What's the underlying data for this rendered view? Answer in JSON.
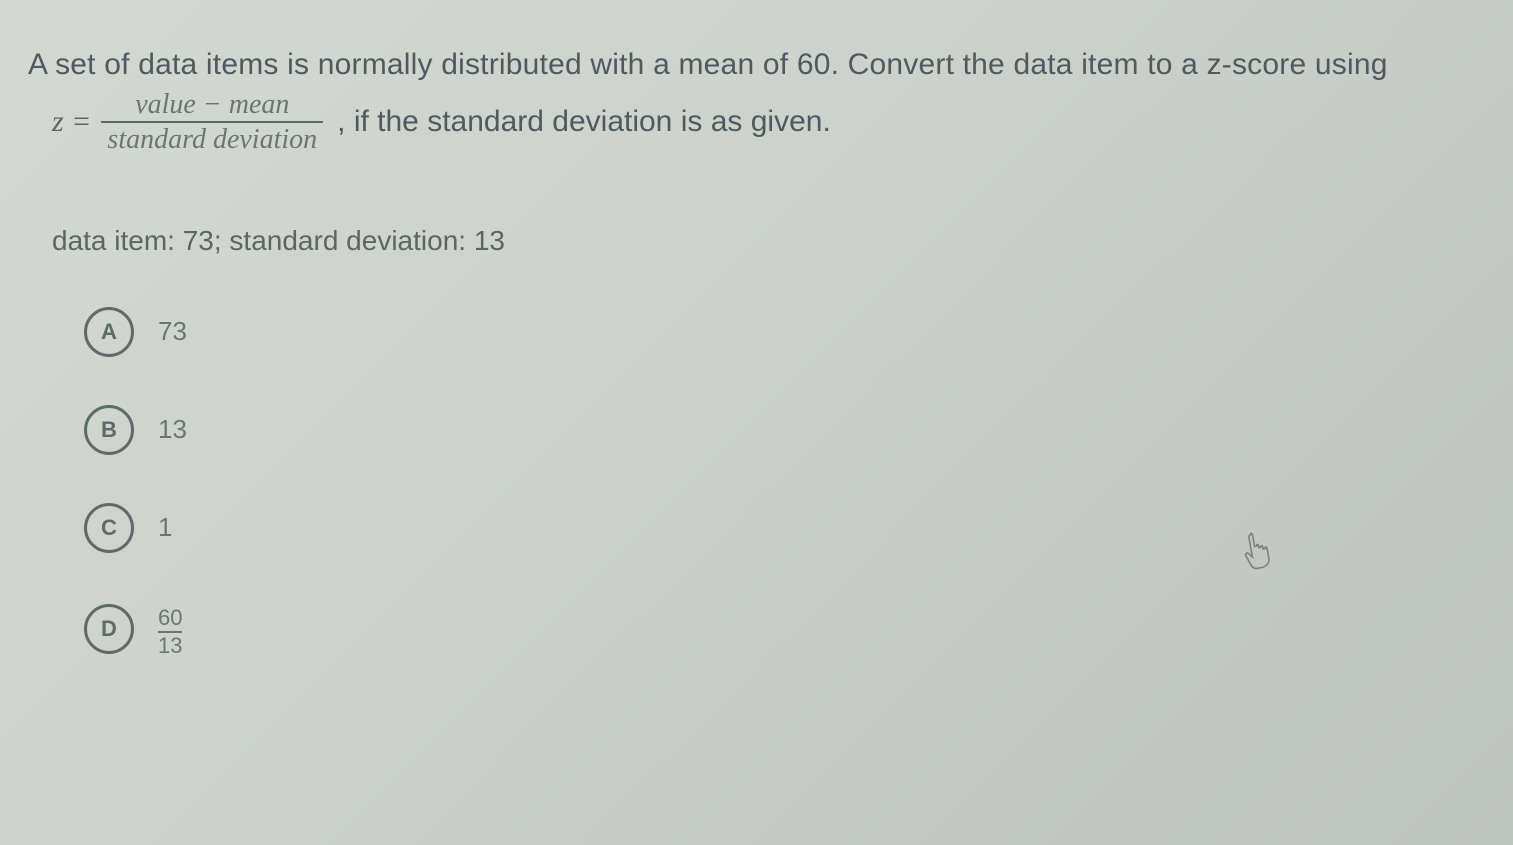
{
  "question": {
    "line1": "A set of data items is normally distributed with a mean of 60. Convert the data item to a z-score using",
    "z_label": "z =",
    "frac_top": "value − mean",
    "frac_bot": "standard deviation",
    "after": ", if the standard deviation is as given."
  },
  "data_line": "data item: 73; standard deviation: 13",
  "options": {
    "a": {
      "letter": "A",
      "text": "73"
    },
    "b": {
      "letter": "B",
      "text": "13"
    },
    "c": {
      "letter": "C",
      "text": "1"
    },
    "d": {
      "letter": "D",
      "frac_top": "60",
      "frac_bot": "13"
    }
  }
}
